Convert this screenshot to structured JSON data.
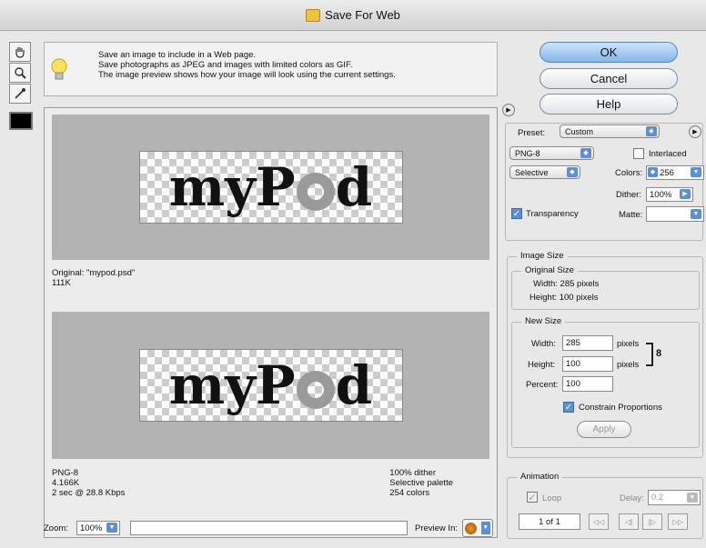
{
  "window": {
    "title": "Save For Web"
  },
  "info": {
    "line1": "Save an image to include in a Web page.",
    "line2": "Save photographs as JPEG and images with limited colors as GIF.",
    "line3": "The image preview shows how your image will look using the current settings."
  },
  "original": {
    "image_text_a": "myP",
    "image_text_b": "d",
    "name": "Original: \"mypod.psd\"",
    "size": "111K"
  },
  "optimized": {
    "image_text_a": "myP",
    "image_text_b": "d",
    "format": "PNG-8",
    "size": "4.166K",
    "time": "2 sec @ 28.8 Kbps",
    "dither": "100% dither",
    "palette": "Selective palette",
    "colors": "254 colors"
  },
  "buttons": {
    "ok": "OK",
    "cancel": "Cancel",
    "help": "Help"
  },
  "settings": {
    "preset_label": "Preset:",
    "preset": "Custom",
    "format": "PNG-8",
    "interlaced_label": "Interlaced",
    "reduction": "Selective",
    "colors_label": "Colors:",
    "colors": "256",
    "dither_label": "Dither:",
    "dither": "100%",
    "transparency_label": "Transparency",
    "matte_label": "Matte:"
  },
  "image_size": {
    "title": "Image Size",
    "original_title": "Original Size",
    "orig_width": "Width:  285 pixels",
    "orig_height": "Height:  100 pixels",
    "new_title": "New Size",
    "width_label": "Width:",
    "width": "285",
    "width_unit": "pixels",
    "height_label": "Height:",
    "height": "100",
    "height_unit": "pixels",
    "percent_label": "Percent:",
    "percent": "100",
    "constrain_label": "Constrain Proportions",
    "apply": "Apply"
  },
  "animation": {
    "title": "Animation",
    "loop_label": "Loop",
    "delay_label": "Delay:",
    "delay": "0.2",
    "frame": "1 of 1"
  },
  "footer": {
    "zoom_label": "Zoom:",
    "zoom": "100%",
    "preview_in_label": "Preview In:"
  }
}
